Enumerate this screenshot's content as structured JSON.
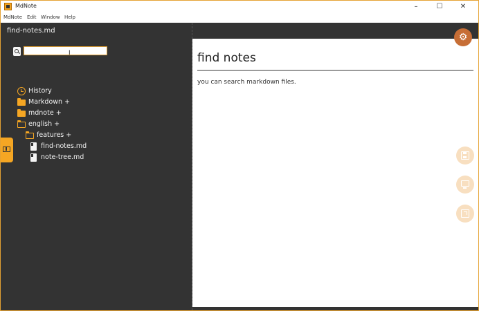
{
  "window": {
    "title": "MdNote",
    "minimize": "–",
    "maximize": "☐",
    "close": "✕"
  },
  "menu": [
    "MdNote",
    "Edit",
    "Window",
    "Help"
  ],
  "sidebar": {
    "filename": "find-notes.md",
    "search": {
      "value": "",
      "placeholder": ""
    },
    "tree": [
      {
        "label": "History",
        "icon": "history-clock-icon"
      },
      {
        "label": "Markdown +",
        "icon": "folder-icon"
      },
      {
        "label": "mdnote +",
        "icon": "folder-icon"
      },
      {
        "label": "english +",
        "icon": "folder-open-icon"
      },
      {
        "label": "features +",
        "icon": "folder-open-icon"
      },
      {
        "label": "find-notes.md",
        "icon": "file-icon"
      },
      {
        "label": "note-tree.md",
        "icon": "file-icon"
      }
    ]
  },
  "document": {
    "title": "find notes",
    "body": "you can search markdown files."
  },
  "actions": {
    "settings_icon": "gear-icon",
    "save_icon": "save-icon",
    "preview_icon": "monitor-icon",
    "export_icon": "export-icon"
  },
  "colors": {
    "accent": "#f5a623",
    "sidebar_bg": "#333333",
    "gear_button": "#c76e36",
    "fab": "#f8dfc0"
  }
}
